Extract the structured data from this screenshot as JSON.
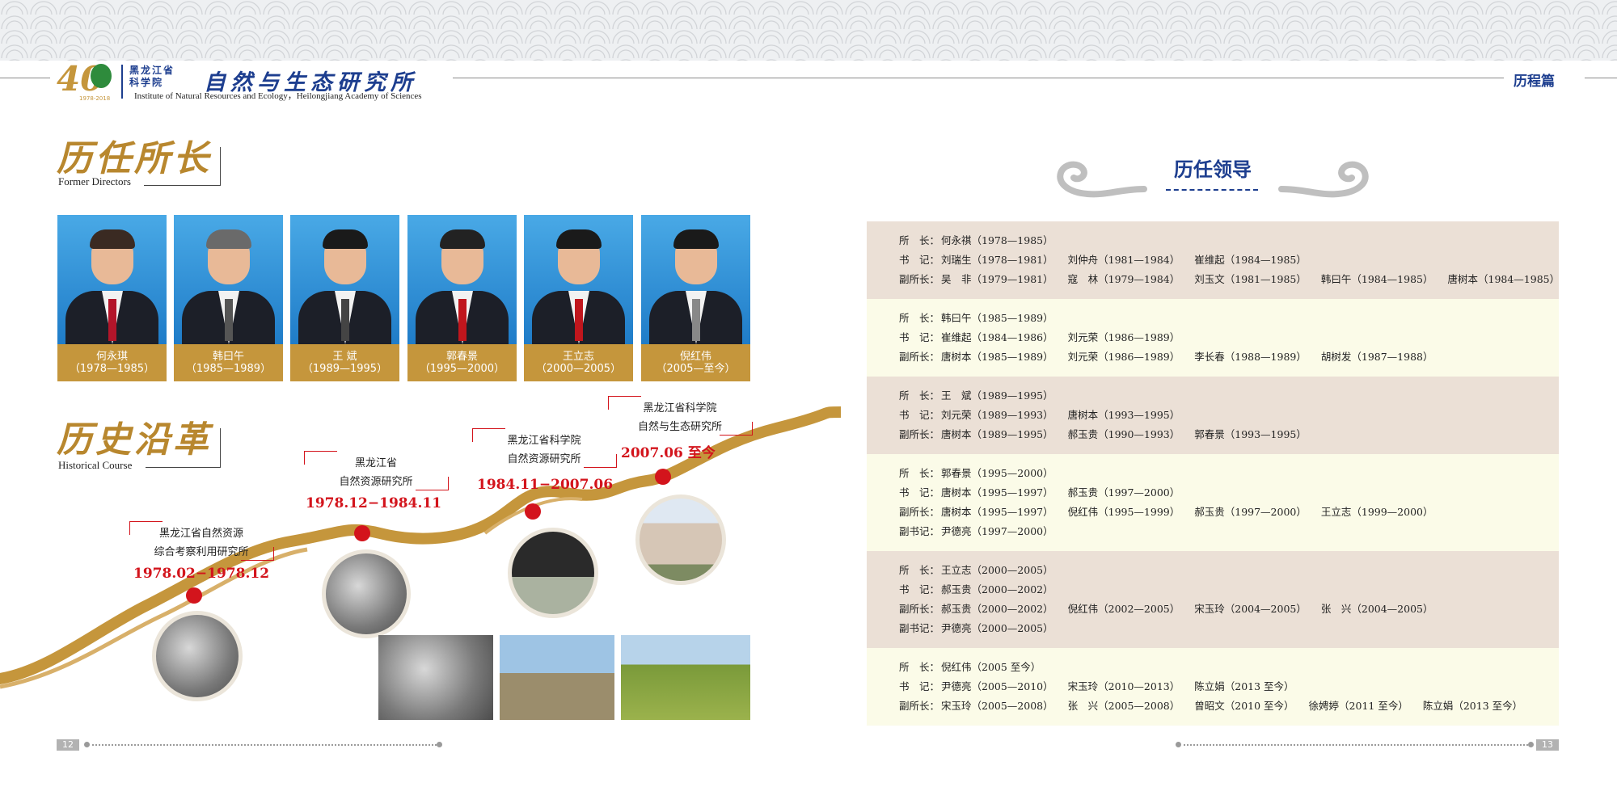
{
  "header": {
    "logo_year": "40",
    "logo_years_range": "1978-2018",
    "inst_cn_small_line1": "黑龙江省",
    "inst_cn_small_line2": "科学院",
    "inst_cn_main": "自然与生态研究所",
    "inst_en": "Institute of Natural Resources and Ecology，Heilongjiang Academy of Sciences",
    "section_name": "历程篇"
  },
  "directors_section": {
    "title_cn": "历任所长",
    "title_en": "Former Directors",
    "directors": [
      {
        "name": "何永琪",
        "term": "（1978—1985）"
      },
      {
        "name": "韩曰午",
        "term": "（1985—1989）"
      },
      {
        "name": "王   斌",
        "term": "（1989—1995）"
      },
      {
        "name": "郭春景",
        "term": "（1995—2000）"
      },
      {
        "name": "王立志",
        "term": "（2000—2005）"
      },
      {
        "name": "倪红伟",
        "term": "（2005—至今）"
      }
    ]
  },
  "history_section": {
    "title_cn": "历史沿革",
    "title_en": "Historical Course",
    "milestones": [
      {
        "line1": "黑龙江省自然资源",
        "line2": "综合考察利用研究所",
        "date": "1978.02−1978.12"
      },
      {
        "line1": "黑龙江省",
        "line2": "自然资源研究所",
        "date": "1978.12−1984.11"
      },
      {
        "line1": "黑龙江省科学院",
        "line2": "自然资源研究所",
        "date": "1984.11−2007.06"
      },
      {
        "line1": "黑龙江省科学院",
        "line2": "自然与生态研究所",
        "date": "2007.06 至今"
      }
    ]
  },
  "leaders_section": {
    "title": "历任领导",
    "terms": [
      {
        "rows": [
          {
            "role": "所　长：",
            "people": [
              "何永祺（1978—1985）"
            ]
          },
          {
            "role": "书　记：",
            "people": [
              "刘瑞生（1978—1981）",
              "刘仲舟（1981—1984）",
              "崔维起（1984—1985）"
            ]
          },
          {
            "role": "副所长：",
            "people": [
              "吴　非（1979—1981）",
              "寇　林（1979—1984）",
              "刘玉文（1981—1985）",
              "韩曰午（1984—1985）",
              "唐树本（1984—1985）"
            ]
          }
        ]
      },
      {
        "rows": [
          {
            "role": "所　长：",
            "people": [
              "韩曰午（1985—1989）"
            ]
          },
          {
            "role": "书　记：",
            "people": [
              "崔维起（1984—1986）",
              "刘元荣（1986—1989）"
            ]
          },
          {
            "role": "副所长：",
            "people": [
              "唐树本（1985—1989）",
              "刘元荣（1986—1989）",
              "李长春（1988—1989）",
              "胡树发（1987—1988）"
            ]
          }
        ]
      },
      {
        "rows": [
          {
            "role": "所　长：",
            "people": [
              "王　斌（1989—1995）"
            ]
          },
          {
            "role": "书　记：",
            "people": [
              "刘元荣（1989—1993）",
              "唐树本（1993—1995）"
            ]
          },
          {
            "role": "副所长：",
            "people": [
              "唐树本（1989—1995）",
              "郝玉贵（1990—1993）",
              "郭春景（1993—1995）"
            ]
          }
        ]
      },
      {
        "rows": [
          {
            "role": "所　长：",
            "people": [
              "郭春景（1995—2000）"
            ]
          },
          {
            "role": "书　记：",
            "people": [
              "唐树本（1995—1997）",
              "郝玉贵（1997—2000）"
            ]
          },
          {
            "role": "副所长：",
            "people": [
              "唐树本（1995—1997）",
              "倪红伟（1995—1999）",
              "郝玉贵（1997—2000）",
              "王立志（1999—2000）"
            ]
          },
          {
            "role": "副书记：",
            "people": [
              "尹德亮（1997—2000）"
            ]
          }
        ]
      },
      {
        "rows": [
          {
            "role": "所　长：",
            "people": [
              "王立志（2000—2005）"
            ]
          },
          {
            "role": "书　记：",
            "people": [
              "郝玉贵（2000—2002）"
            ]
          },
          {
            "role": "副所长：",
            "people": [
              "郝玉贵（2000—2002）",
              "倪红伟（2002—2005）",
              "宋玉玲（2004—2005）",
              "张　兴（2004—2005）"
            ]
          },
          {
            "role": "副书记：",
            "people": [
              "尹德亮（2000—2005）"
            ]
          }
        ]
      },
      {
        "rows": [
          {
            "role": "所　长：",
            "people": [
              "倪红伟（2005 至今）"
            ]
          },
          {
            "role": "书　记：",
            "people": [
              "尹德亮（2005—2010）",
              "宋玉玲（2010—2013）",
              "陈立娟（2013 至今）"
            ]
          },
          {
            "role": "副所长：",
            "people": [
              "宋玉玲（2005—2008）",
              "张　兴（2005—2008）",
              "曾昭文（2010 至今）",
              "徐娉婷（2011 至今）",
              "陈立娟（2013 至今）"
            ]
          }
        ]
      }
    ]
  },
  "footer": {
    "page_left": "12",
    "page_right": "13"
  },
  "colors": {
    "brand_blue": "#1d3e8f",
    "gold": "#c5963c",
    "red": "#d3141c"
  }
}
